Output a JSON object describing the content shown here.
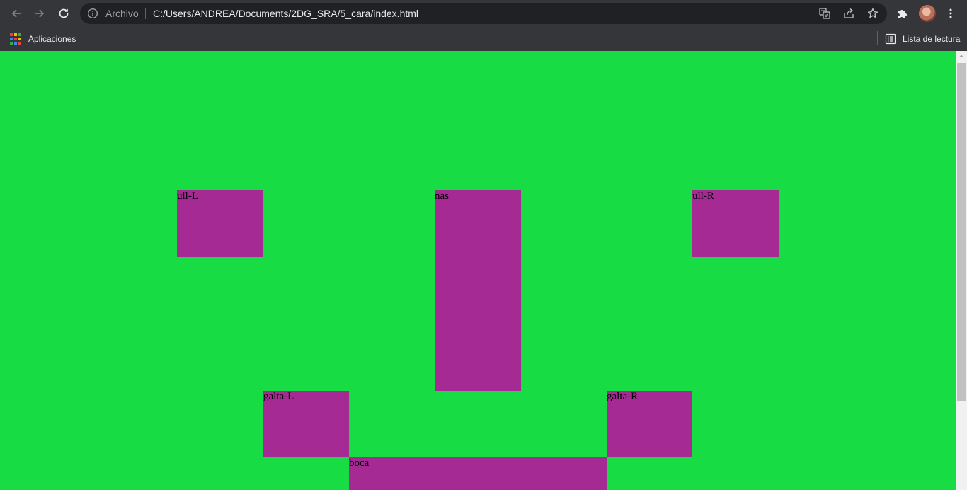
{
  "browser": {
    "omnibox": {
      "scheme_label": "Archivo",
      "url": "C:/Users/ANDREA/Documents/2DG_SRA/5_cara/index.html"
    },
    "icons": {
      "back": "arrow-left-icon",
      "forward": "arrow-right-icon",
      "reload": "reload-icon",
      "site_info": "info-icon",
      "translate": "translate-icon",
      "share": "share-icon",
      "bookmark": "star-icon",
      "extensions": "puzzle-icon",
      "menu": "kebab-menu-icon"
    },
    "bookmarks_bar": {
      "apps_label": "Aplicaciones",
      "reading_list_label": "Lista de lectura"
    }
  },
  "page": {
    "background_color": "#18dc44",
    "box_color": "#a52a94",
    "boxes": {
      "ull_l": "ull-L",
      "nas": "nas",
      "ull_r": "ull-R",
      "galta_l": "galta-L",
      "galta_r": "galta-R",
      "boca": "boca"
    }
  }
}
